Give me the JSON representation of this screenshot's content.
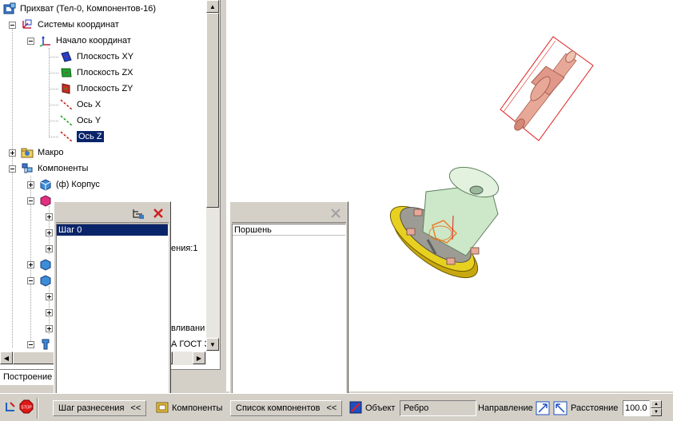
{
  "tree": {
    "root": "Прихват (Тел-0, Компонентов-16)",
    "coord_systems": "Системы координат",
    "origin": "Начало координат",
    "plane_xy": "Плоскость XY",
    "plane_zx": "Плоскость ZX",
    "plane_zy": "Плоскость ZY",
    "axis_x": "Ось X",
    "axis_y": "Ось Y",
    "axis_z": "Ось Z",
    "macro": "Макро",
    "components": "Компоненты",
    "body": "(ф) Корпус",
    "partial_1": "ения:1",
    "partial_2": "вливани",
    "partial_3": "А ГОСТ 3"
  },
  "tabs": {
    "build": "Построение"
  },
  "steps_panel": {
    "items": [
      "Шаг 0"
    ]
  },
  "components_panel": {
    "items": [
      "Поршень"
    ]
  },
  "toolbar": {
    "steps_label": "Шаг разнесения",
    "steps_chevron": "<<",
    "components_label": "Компоненты",
    "list_label": "Список компонентов",
    "list_chevron": "<<",
    "object_label": "Объект",
    "object_value": "Ребро",
    "direction_label": "Направление",
    "distance_label": "Расстояние",
    "distance_value": "100.0",
    "stop_label": "STOP"
  },
  "colors": {
    "selection": "#0a246a",
    "panel": "#d4d0c8",
    "part_red": "#e8a898",
    "part_green": "#cde8c8",
    "part_yellow": "#e8d020",
    "bbox_red": "#e02020"
  }
}
